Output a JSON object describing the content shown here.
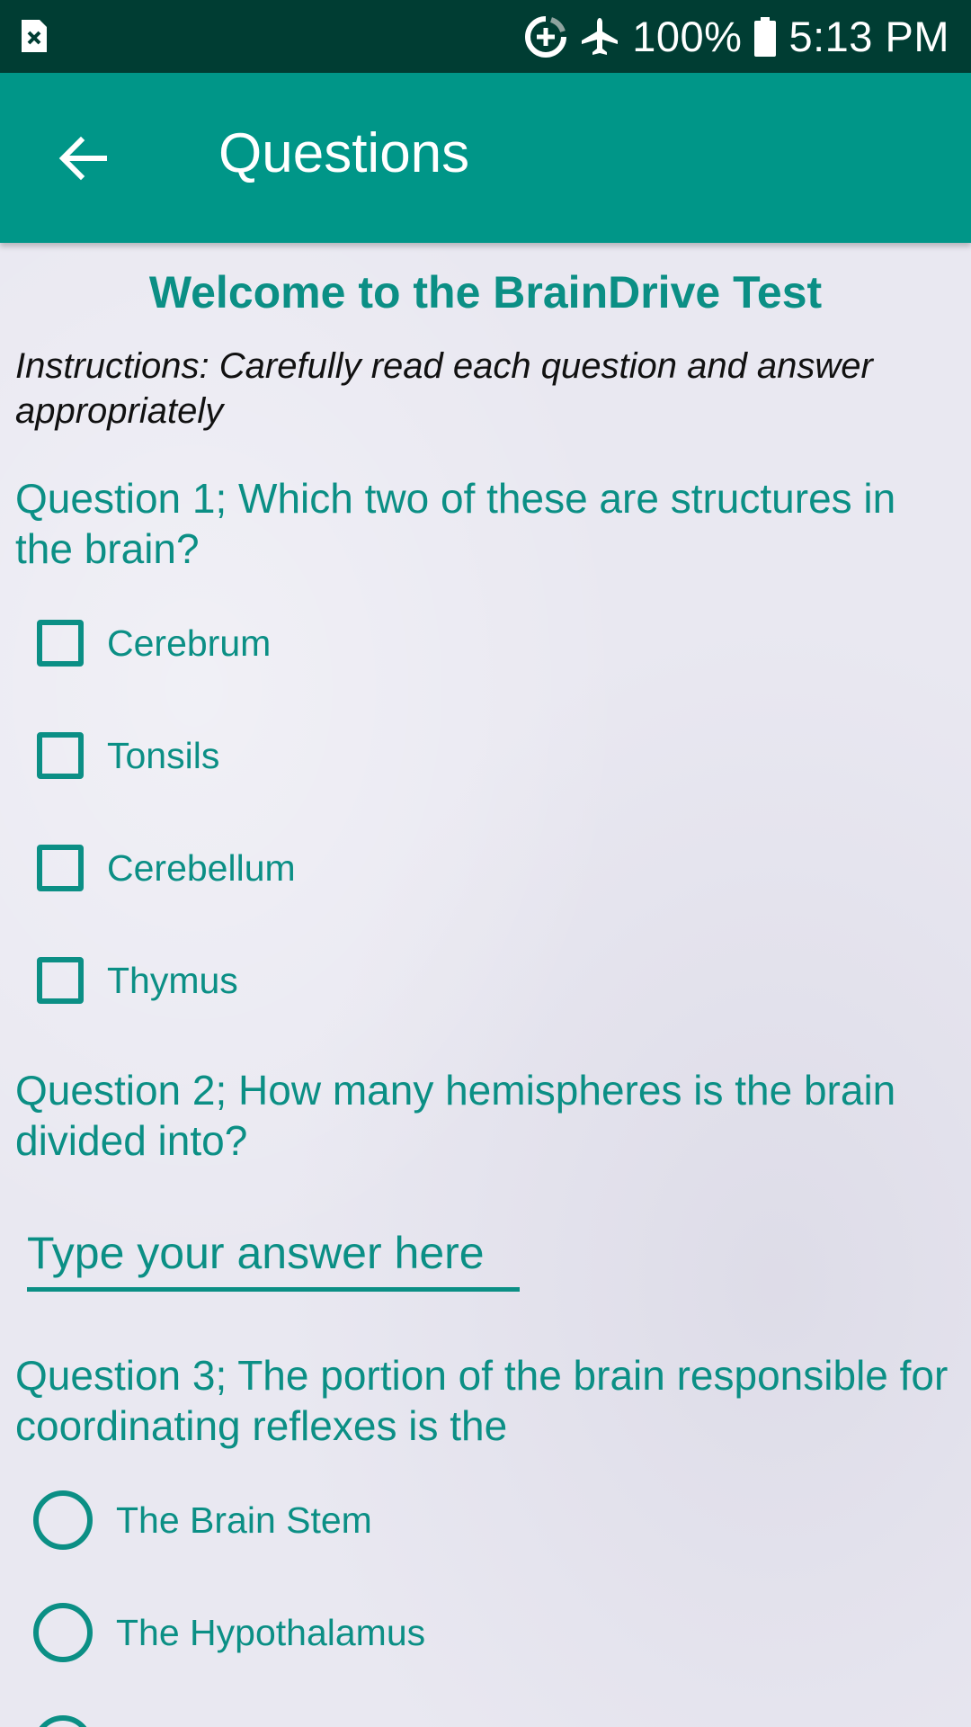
{
  "status_bar": {
    "battery": "100%",
    "time": "5:13 PM",
    "icons": [
      "file-x-icon",
      "data-saver-icon",
      "airplane-mode-icon",
      "battery-icon"
    ]
  },
  "app_bar": {
    "title": "Questions",
    "back_icon": "arrow-back-icon",
    "color": "#009688"
  },
  "content": {
    "heading": "Welcome to the BrainDrive Test",
    "instructions": "Instructions: Carefully read each question and answer appropriately",
    "accent_color": "#0b8f85",
    "questions": [
      {
        "text": "Question 1; Which two of these are structures in the brain?",
        "type": "checkbox",
        "options": [
          "Cerebrum",
          "Tonsils",
          "Cerebellum",
          "Thymus"
        ]
      },
      {
        "text": "Question 2; How many hemispheres is the brain divided into?",
        "type": "text",
        "value": "",
        "placeholder": "Type your answer here"
      },
      {
        "text": "Question 3; The portion of the brain responsible for coordinating reflexes is the",
        "type": "radio",
        "options": [
          "The Brain Stem",
          "The Hypothalamus"
        ]
      }
    ]
  }
}
